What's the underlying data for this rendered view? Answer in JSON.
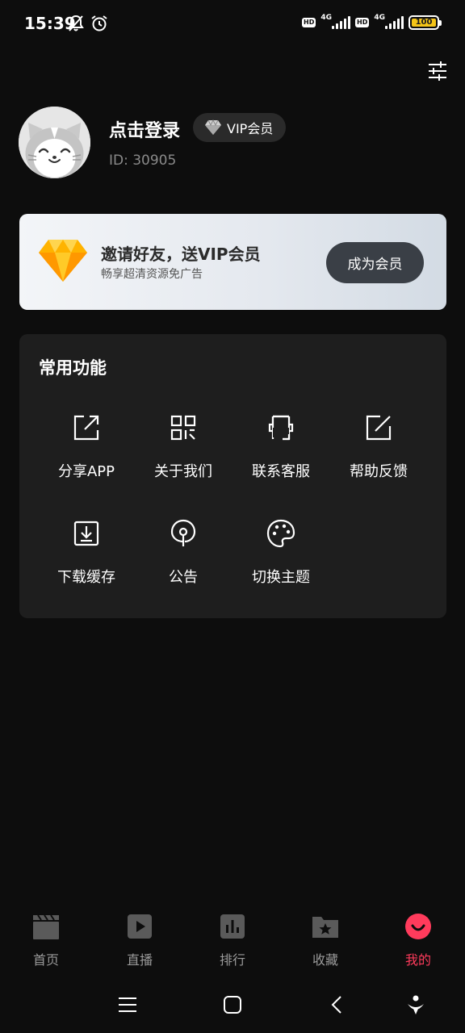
{
  "status_bar": {
    "time": "15:39",
    "network_1": "4G",
    "network_2": "4G",
    "hd_1": "HD",
    "hd_2": "HD",
    "battery": "100",
    "battery_color": "#f5c518"
  },
  "profile": {
    "login_text": "点击登录",
    "vip_badge": "VIP会员",
    "user_id": "ID: 30905"
  },
  "banner": {
    "title": "邀请好友，送VIP会员",
    "subtitle": "畅享超清资源免广告",
    "button": "成为会员"
  },
  "functions": {
    "title": "常用功能",
    "items": [
      {
        "label": "分享APP",
        "icon": "share-icon"
      },
      {
        "label": "关于我们",
        "icon": "qrcode-icon"
      },
      {
        "label": "联系客服",
        "icon": "customer-service-icon"
      },
      {
        "label": "帮助反馈",
        "icon": "edit-icon"
      },
      {
        "label": "下载缓存",
        "icon": "download-icon"
      },
      {
        "label": "公告",
        "icon": "announcement-icon"
      },
      {
        "label": "切换主题",
        "icon": "palette-icon"
      }
    ]
  },
  "bottom_nav": {
    "items": [
      {
        "label": "首页",
        "icon": "clapperboard-icon"
      },
      {
        "label": "直播",
        "icon": "play-icon"
      },
      {
        "label": "排行",
        "icon": "bar-chart-icon"
      },
      {
        "label": "收藏",
        "icon": "folder-star-icon"
      },
      {
        "label": "我的",
        "icon": "smile-icon",
        "active": true
      }
    ],
    "active_color": "#ff3b5c",
    "inactive_color": "#9a9a9a"
  }
}
